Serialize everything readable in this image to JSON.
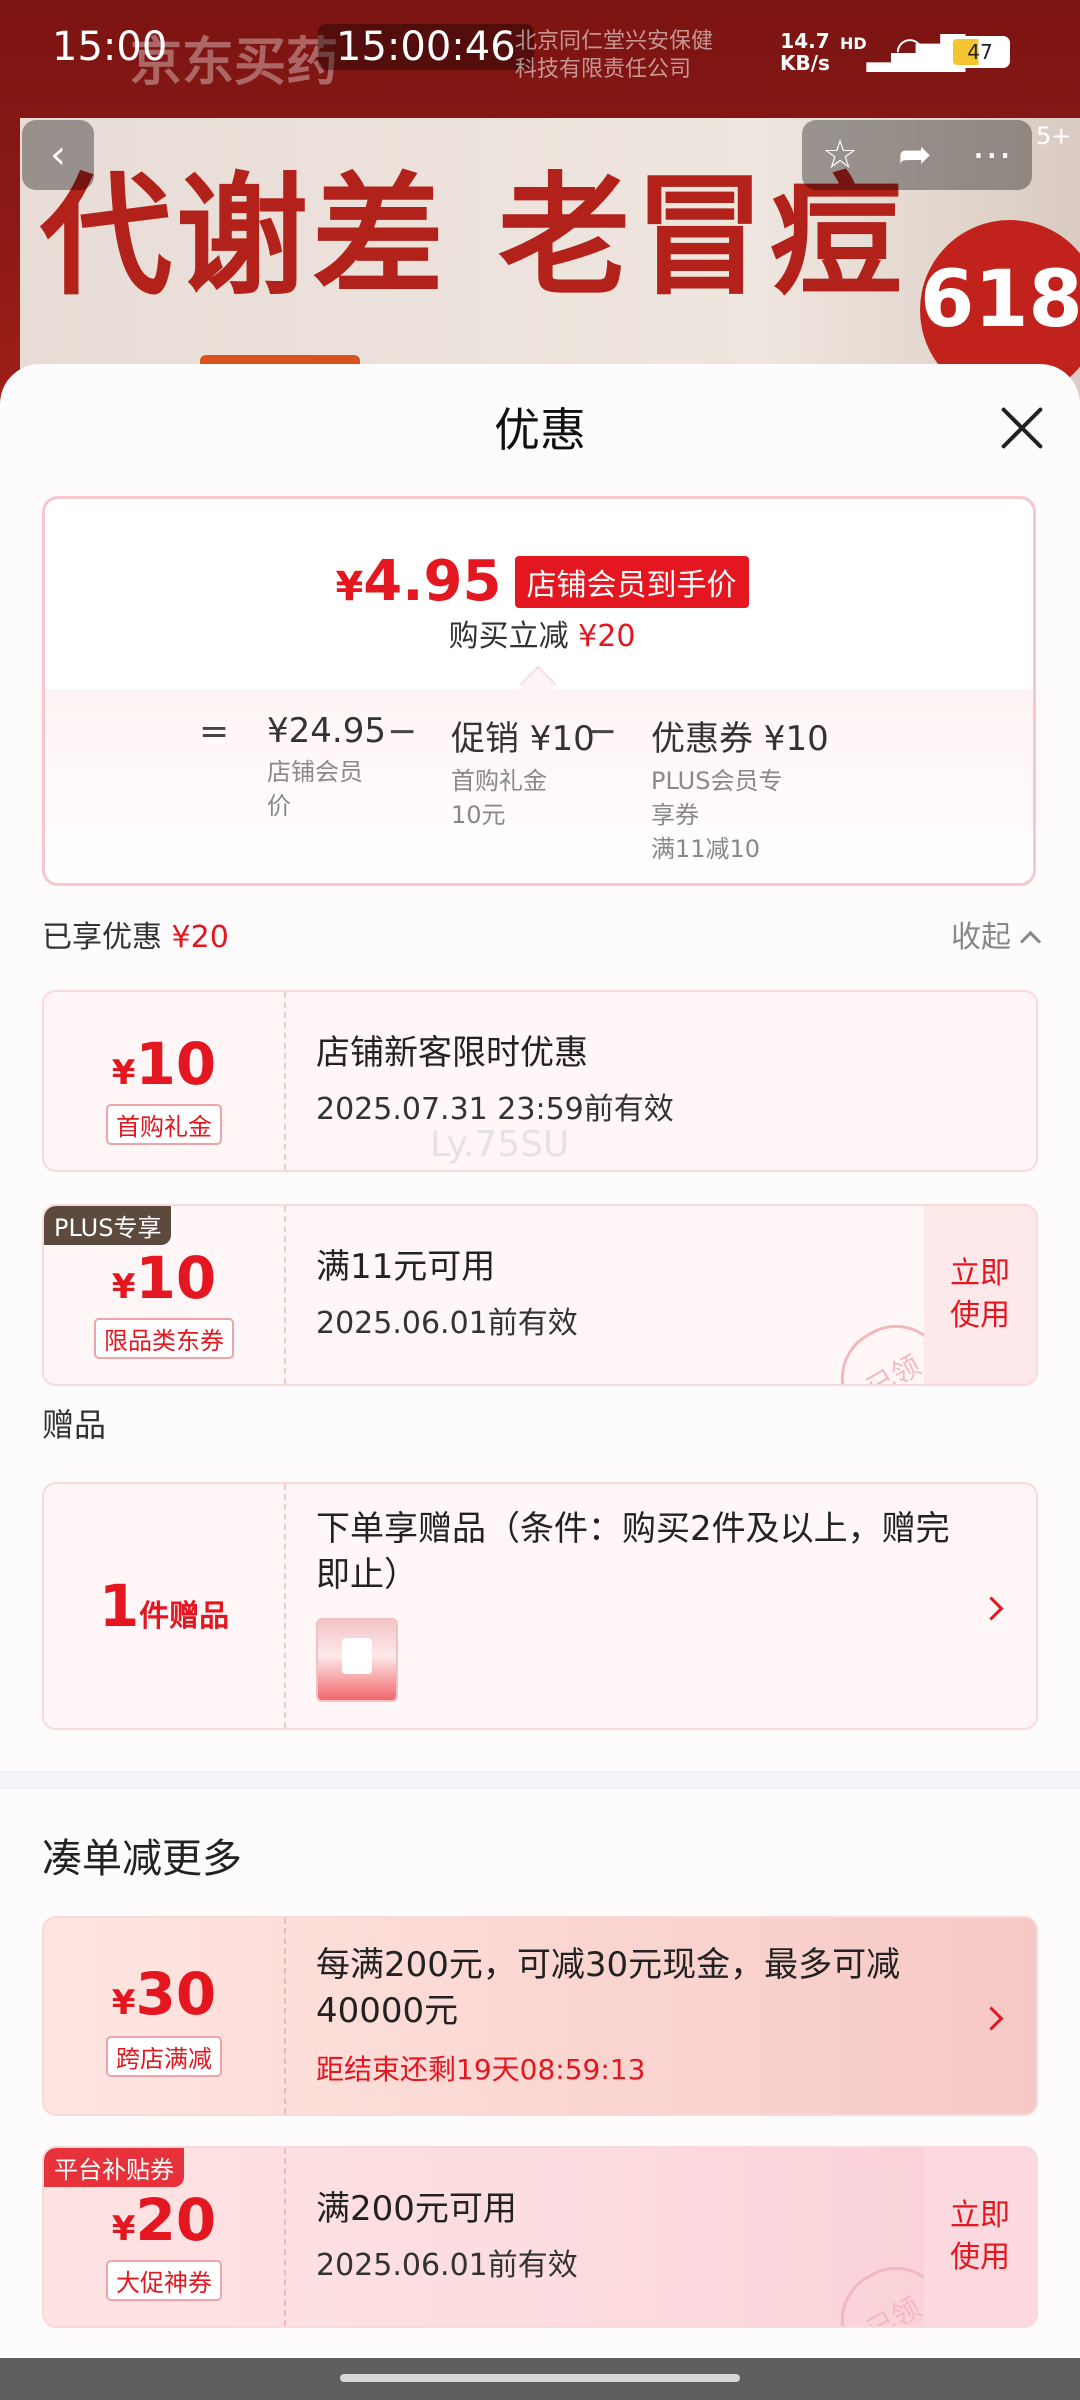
{
  "status_bar": {
    "time": "15:00",
    "clock_overlay": "15:00:46",
    "brand_watermark": "京东买药",
    "corp_line1": "北京同仁堂兴安保健",
    "corp_line2": "科技有限责任公司",
    "net_speed_value": "14.7",
    "net_speed_unit": "KB/s",
    "hd_label": "HD",
    "battery": "47"
  },
  "product_banner": {
    "headline": "代谢差 老冒痘",
    "badge": "618",
    "image_count": "5+"
  },
  "icons": {
    "back": "chevron-left",
    "favorite": "star",
    "share": "share",
    "more": "ellipsis",
    "close": "close"
  },
  "sheet": {
    "title": "优惠"
  },
  "summary": {
    "price_symbol": "¥",
    "price": "4.95",
    "price_tag": "店铺会员到手价",
    "sub_text": "购买立减",
    "sub_amount": "¥20",
    "breakdown": [
      {
        "op": "=",
        "main": "¥24.95",
        "sub": [
          "店铺会员",
          "价"
        ]
      },
      {
        "op": "−",
        "main": "促销 ¥10",
        "sub": [
          "首购礼金",
          "10元"
        ]
      },
      {
        "op": "−",
        "main": "优惠券 ¥10",
        "sub": [
          "PLUS会员专",
          "享券",
          "满11减10"
        ]
      }
    ]
  },
  "enjoyed": {
    "label": "已享优惠",
    "amount": "¥20",
    "collapse_label": "收起"
  },
  "coupons": [
    {
      "yen": "¥",
      "amount": "10",
      "tag": "首购礼金",
      "title": "店铺新客限时优惠",
      "detail": "2025.07.31 23:59前有效"
    },
    {
      "corner_tag": "PLUS专享",
      "yen": "¥",
      "amount": "10",
      "tag": "限品类东券",
      "title": "满11元可用",
      "detail": "2025.06.01前有效",
      "action": "立即使用",
      "stamp": "已领"
    }
  ],
  "gift": {
    "section_title": "赠品",
    "count": "1",
    "count_unit": "件赠品",
    "title": "下单享赠品（条件：购买2件及以上，赠完即止）"
  },
  "more": {
    "section_title": "凑单减更多",
    "items": [
      {
        "yen": "¥",
        "amount": "30",
        "tag": "跨店满减",
        "title": "每满200元，可减30元现金，最多可减40000元",
        "countdown": "距结束还剩19天08:59:13"
      },
      {
        "corner_tag": "平台补贴券",
        "yen": "¥",
        "amount": "20",
        "tag": "大促神券",
        "title": "满200元可用",
        "detail": "2025.06.01前有效",
        "action": "立即使用",
        "stamp": "已领"
      }
    ]
  },
  "watermark": "Ly.75SU",
  "colors": {
    "accent_red": "#e4161f",
    "plus_tag_bg": "#5b4a3d",
    "platform_tag_bg": "#e8323b"
  }
}
